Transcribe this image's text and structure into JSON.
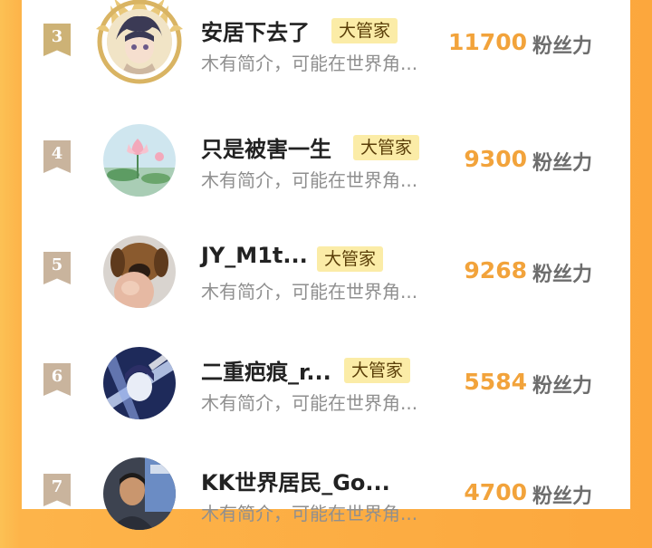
{
  "rows": [
    {
      "rank": "3",
      "name": "安居下去了",
      "badge": "大管家",
      "desc": "木有简介，可能在世界角...",
      "count": "11700",
      "unit": "粉丝力",
      "avatar_icon": "anime-girl-avatar",
      "frame_icon": "gold-crown-frame"
    },
    {
      "rank": "4",
      "name": "只是被害一生",
      "badge": "大管家",
      "desc": "木有简介，可能在世界角...",
      "count": "9300",
      "unit": "粉丝力",
      "avatar_icon": "lotus-flower-avatar"
    },
    {
      "rank": "5",
      "name": "JY_M1t...",
      "badge": "大管家",
      "desc": "木有简介，可能在世界角...",
      "count": "9268",
      "unit": "粉丝力",
      "avatar_icon": "dog-photo-avatar"
    },
    {
      "rank": "6",
      "name": "二重疤痕_r...",
      "badge": "大管家",
      "desc": "木有简介，可能在世界角...",
      "count": "5584",
      "unit": "粉丝力",
      "avatar_icon": "anime-character-avatar"
    },
    {
      "rank": "7",
      "name": "KK世界居民_Go...",
      "badge": "",
      "desc": "木有简介，可能在世界角...",
      "count": "4700",
      "unit": "粉丝力",
      "avatar_icon": "person-photo-avatar"
    }
  ],
  "colors": {
    "accent_orange": "#f2a33b",
    "badge_bg": "#fbeca7",
    "rank_badge": "#c9b49d"
  }
}
